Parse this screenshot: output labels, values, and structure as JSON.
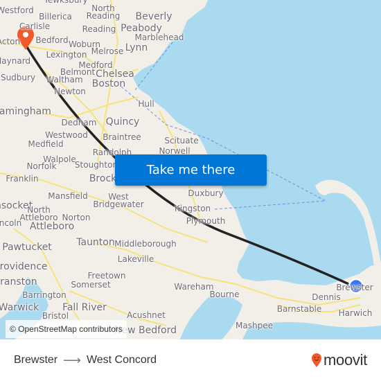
{
  "map": {
    "water_color": "#aadaef",
    "land_color": "#f2efe9",
    "road_color": "#f8e16c",
    "route_color": "#222222",
    "origin_marker_color": "#3478f6",
    "destination_marker_color": "#f05a28",
    "attribution": "© OpenStreetMap contributors",
    "places": [
      {
        "name": "Tewksbury"
      },
      {
        "name": "Westford"
      },
      {
        "name": "Billerica"
      },
      {
        "name": "North"
      },
      {
        "name": "Reading"
      },
      {
        "name": "Beverly"
      },
      {
        "name": "Carlisle"
      },
      {
        "name": "Reading"
      },
      {
        "name": "Peabody"
      },
      {
        "name": "Bedford"
      },
      {
        "name": "Marblehead"
      },
      {
        "name": "Acton"
      },
      {
        "name": "Woburn"
      },
      {
        "name": "Lynn"
      },
      {
        "name": "Lexington"
      },
      {
        "name": "Melrose"
      },
      {
        "name": "Maynard"
      },
      {
        "name": "Medford"
      },
      {
        "name": "Belmont"
      },
      {
        "name": "Chelsea"
      },
      {
        "name": "Sudbury"
      },
      {
        "name": "Waltham"
      },
      {
        "name": "Boston"
      },
      {
        "name": "Newton"
      },
      {
        "name": "Hull"
      },
      {
        "name": "Framingham"
      },
      {
        "name": "Dedham"
      },
      {
        "name": "Quincy"
      },
      {
        "name": "Westwood"
      },
      {
        "name": "Braintree"
      },
      {
        "name": "Medfield"
      },
      {
        "name": "Scituate"
      },
      {
        "name": "Randolph"
      },
      {
        "name": "Norwell"
      },
      {
        "name": "Walpole"
      },
      {
        "name": "Norfolk"
      },
      {
        "name": "Stoughton"
      },
      {
        "name": "Franklin"
      },
      {
        "name": "Brockton"
      },
      {
        "name": "Duxbury"
      },
      {
        "name": "Mansfield"
      },
      {
        "name": "West"
      },
      {
        "name": "Bridgewater"
      },
      {
        "name": "Kingston"
      },
      {
        "name": "Woonsocket"
      },
      {
        "name": "North"
      },
      {
        "name": "Attleboro"
      },
      {
        "name": "Norton"
      },
      {
        "name": "Plymouth"
      },
      {
        "name": "Lincoln"
      },
      {
        "name": "Attleboro"
      },
      {
        "name": "Pawtucket"
      },
      {
        "name": "Taunton"
      },
      {
        "name": "Middleborough"
      },
      {
        "name": "Providence"
      },
      {
        "name": "Lakeville"
      },
      {
        "name": "Freetown"
      },
      {
        "name": "Cranston"
      },
      {
        "name": "Somerset"
      },
      {
        "name": "Brewster"
      },
      {
        "name": "Wareham"
      },
      {
        "name": "Barrington"
      },
      {
        "name": "Bourne"
      },
      {
        "name": "Dennis"
      },
      {
        "name": "Warwick"
      },
      {
        "name": "Fall River"
      },
      {
        "name": "Barnstable"
      },
      {
        "name": "Harwich"
      },
      {
        "name": "Bristol"
      },
      {
        "name": "Mashpee"
      },
      {
        "name": "Acushnet"
      },
      {
        "name": "New Bedford"
      }
    ]
  },
  "cta": {
    "label": "Take me there"
  },
  "footer": {
    "origin": "Brewster",
    "arrow": "⟶",
    "destination": "West Concord",
    "logo_text": "moovit",
    "logo_color": "#f05a28"
  }
}
